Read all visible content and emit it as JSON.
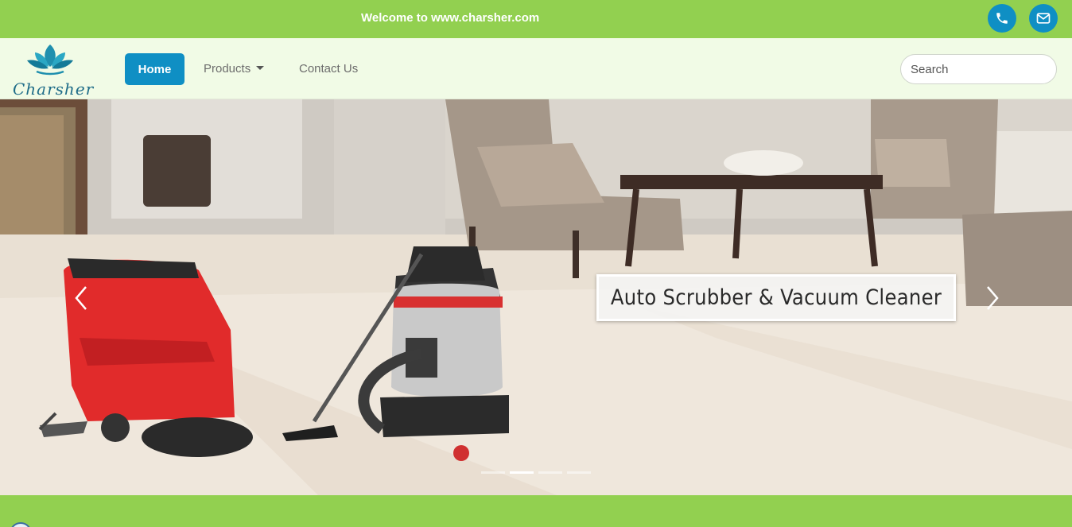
{
  "topbar": {
    "welcome_text": "Welcome to www.charsher.com",
    "phone_icon": "phone-icon",
    "mail_icon": "mail-icon",
    "accent_color": "#92d050",
    "button_color": "#0f8fc4"
  },
  "navbar": {
    "brand": "Charsher",
    "logo_icon": "lotus-icon",
    "home_label": "Home",
    "products_label": "Products",
    "contact_label": "Contact Us",
    "search_placeholder": "Search"
  },
  "carousel": {
    "caption": "Auto Scrubber & Vacuum Cleaner",
    "slide_count": 4,
    "active_slide": 2,
    "prev_icon": "chevron-left-icon",
    "next_icon": "chevron-right-icon"
  }
}
